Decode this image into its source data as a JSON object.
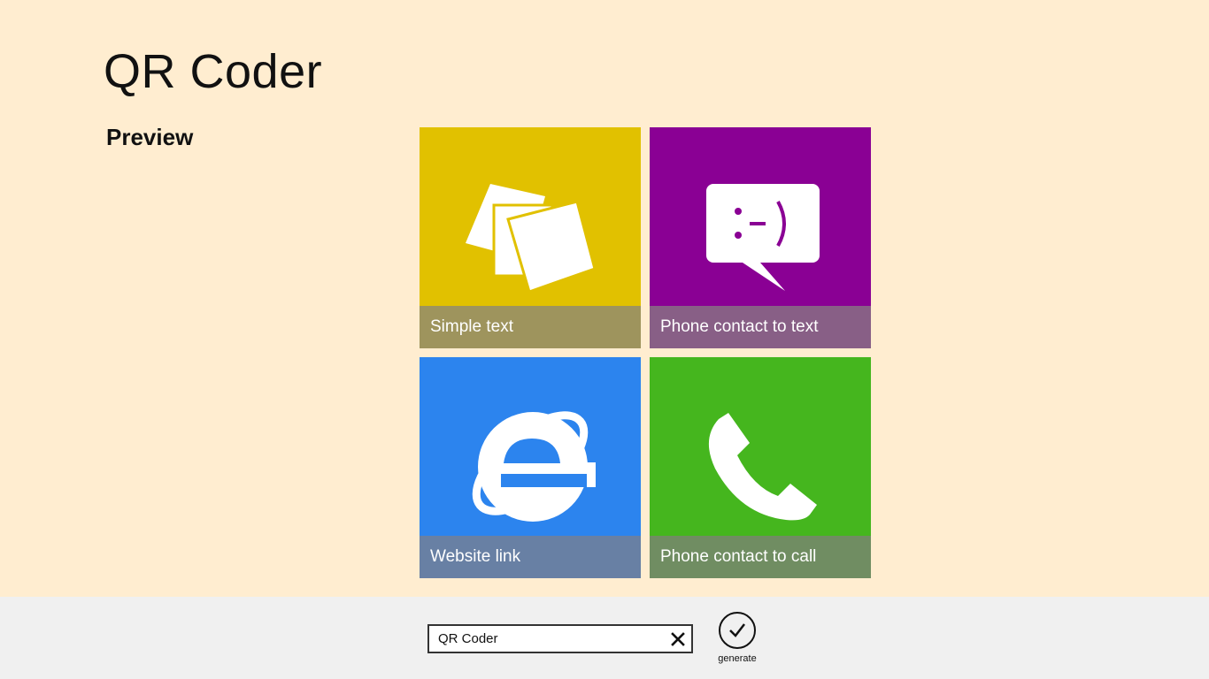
{
  "app": {
    "title": "QR Coder",
    "section_title": "Preview"
  },
  "tiles": [
    {
      "label": "Simple text",
      "icon": "notes-icon",
      "color": "#E1C100",
      "band_color": "#9E945D"
    },
    {
      "label": "Phone contact to text",
      "icon": "chat-bubble-icon",
      "color": "#8A0094",
      "band_color": "#885F86"
    },
    {
      "label": "Website link",
      "icon": "internet-explorer-icon",
      "color": "#2C84EE",
      "band_color": "#6880A4"
    },
    {
      "label": "Phone contact to call",
      "icon": "phone-icon",
      "color": "#45B61E",
      "band_color": "#708D62"
    }
  ],
  "app_bar": {
    "input_value": "QR Coder",
    "clear_icon": "close-icon",
    "generate_icon": "checkmark-icon",
    "generate_label": "generate"
  }
}
